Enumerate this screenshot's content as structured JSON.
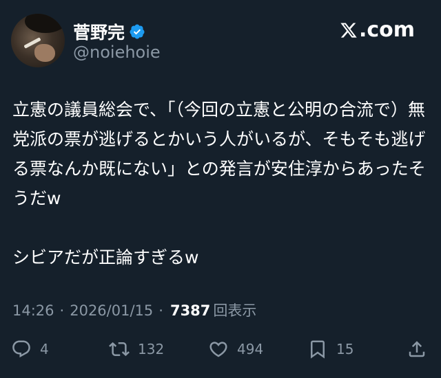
{
  "user": {
    "display_name": "菅野完",
    "handle": "@noiehoie"
  },
  "brand": {
    "label": ".com"
  },
  "post": {
    "text": "立憲の議員総会で、「（今回の立憲と公明の合流で）無党派の票が逃げるとかいう人がいるが、そもそも逃げる票なんか既にない」との発言が安住淳からあったそうだw\n\nシビアだが正論すぎるw"
  },
  "meta": {
    "time": "14:26",
    "separator1": "·",
    "date": "2026/01/15",
    "separator2": "·",
    "views_count": "7387",
    "views_label": "回表示"
  },
  "actions": {
    "reply_count": "4",
    "repost_count": "132",
    "like_count": "494",
    "bookmark_count": "15"
  },
  "colors": {
    "background": "#15202b",
    "text": "#e7e9ea",
    "muted": "#8b98a5",
    "verified": "#1d9bf0"
  },
  "icons": {
    "verified": "verified-badge-icon",
    "brand": "x-logo-icon",
    "reply": "reply-icon",
    "repost": "repost-icon",
    "like": "heart-icon",
    "bookmark": "bookmark-icon",
    "share": "share-icon"
  }
}
